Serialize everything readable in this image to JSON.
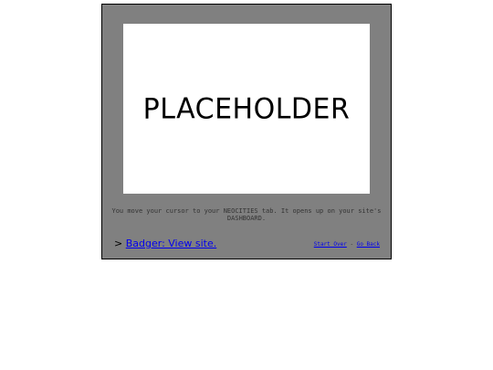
{
  "panel": {
    "image_placeholder_text": "PLACEHOLDER",
    "caption": "You move your cursor to your NEOCITIES tab. It opens up on your site's DASHBOARD.",
    "next_prompt": ">",
    "next_link_label": "Badger: View site.",
    "start_over_label": "Start Over",
    "separator": "-",
    "go_back_label": "Go Back"
  },
  "colors": {
    "panel_background": "#808080",
    "link": "#0000ee"
  }
}
